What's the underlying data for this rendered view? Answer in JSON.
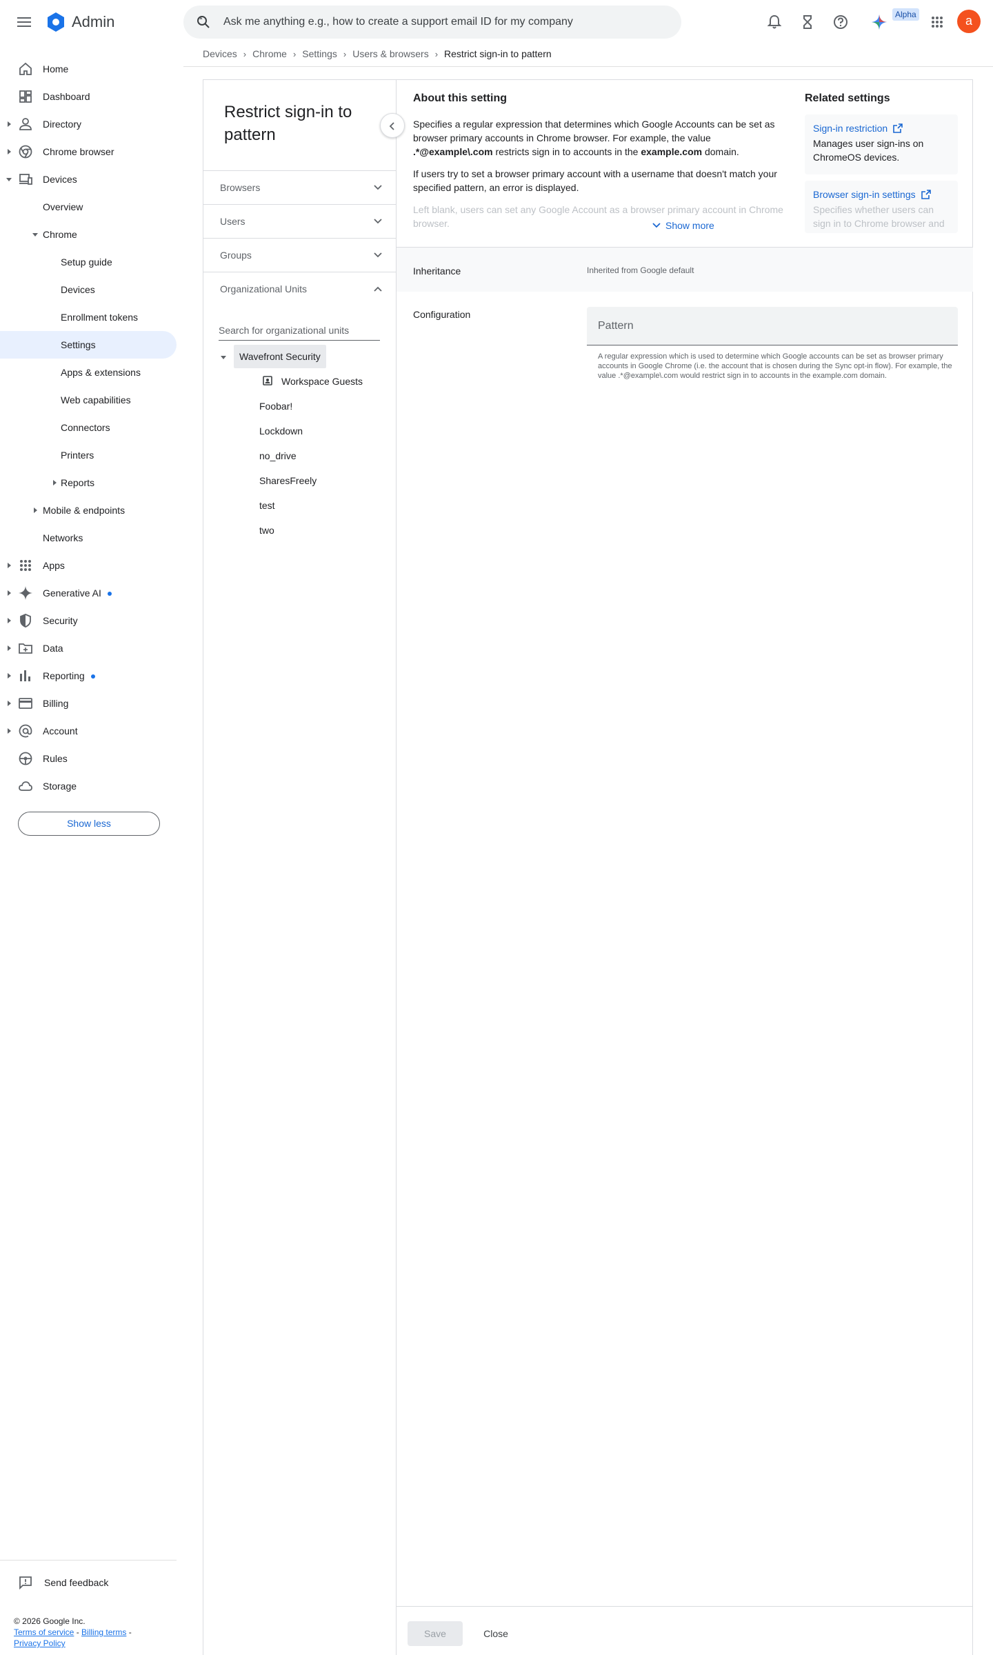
{
  "app": {
    "title": "Admin",
    "brand_color": "#1a73e8",
    "avatar_letter": "a",
    "avatar_color": "#f4511e"
  },
  "search": {
    "placeholder": "Ask me anything e.g., how to create a support email ID for my company"
  },
  "topbar": {
    "alpha_badge": "Alpha",
    "icons": [
      "notifications-icon",
      "hourglass-icon",
      "help-icon",
      "gemini-icon",
      "apps-grid-icon"
    ]
  },
  "breadcrumb": {
    "items": [
      "Devices",
      "Chrome",
      "Settings",
      "Users & browsers"
    ],
    "current": "Restrict sign-in to pattern"
  },
  "sidebar": {
    "items": [
      {
        "label": "Home",
        "icon": "home-icon"
      },
      {
        "label": "Dashboard",
        "icon": "dashboard-icon"
      },
      {
        "label": "Directory",
        "icon": "person-icon"
      },
      {
        "label": "Chrome browser",
        "icon": "chrome-icon"
      },
      {
        "label": "Devices",
        "icon": "devices-icon"
      },
      {
        "label": "Overview"
      },
      {
        "label": "Chrome"
      },
      {
        "label": "Setup guide"
      },
      {
        "label": "Devices"
      },
      {
        "label": "Enrollment tokens"
      },
      {
        "label": "Settings"
      },
      {
        "label": "Apps & extensions"
      },
      {
        "label": "Web capabilities"
      },
      {
        "label": "Connectors"
      },
      {
        "label": "Printers"
      },
      {
        "label": "Reports"
      },
      {
        "label": "Mobile & endpoints"
      },
      {
        "label": "Networks"
      },
      {
        "label": "Apps",
        "icon": "apps-icon"
      },
      {
        "label": "Generative AI",
        "icon": "sparkle-icon"
      },
      {
        "label": "Security",
        "icon": "shield-icon"
      },
      {
        "label": "Data",
        "icon": "data-folder-icon"
      },
      {
        "label": "Reporting",
        "icon": "bar-chart-icon"
      },
      {
        "label": "Billing",
        "icon": "credit-card-icon"
      },
      {
        "label": "Account",
        "icon": "at-sign-icon"
      },
      {
        "label": "Rules",
        "icon": "rules-icon"
      },
      {
        "label": "Storage",
        "icon": "cloud-icon"
      }
    ],
    "show_less": "Show less",
    "feedback": "Send feedback",
    "footer": {
      "copyright": "© 2026 Google Inc.",
      "terms": "Terms of service",
      "billing": "Billing terms",
      "privacy": "Privacy Policy",
      "sep": " - "
    }
  },
  "setting": {
    "title": "Restrict sign-in to pattern",
    "filters": [
      "Browsers",
      "Users",
      "Groups",
      "Organizational Units"
    ],
    "ou_search_placeholder": "Search for organizational units",
    "ou_root": "Wavefront Security",
    "ou_children": [
      "Workspace Guests"
    ],
    "ou_items": [
      "Foobar!",
      "Lockdown",
      "no_drive",
      "SharesFreely",
      "test",
      "two"
    ]
  },
  "about": {
    "title": "About this setting",
    "p1_a": "Specifies a regular expression that determines which Google Accounts can be set as browser primary accounts in Chrome browser. For example, the value ",
    "p1_b": ".*@example\\.com",
    "p1_c": " restricts sign in to accounts in the ",
    "p1_d": "example.com",
    "p1_e": " domain.",
    "p2": "If users try to set a browser primary account with a username that doesn't match your specified pattern, an error is displayed.",
    "p3": "Left blank, users can set any Google Account as a browser primary account in Chrome browser.",
    "show_more": "Show more"
  },
  "related": {
    "title": "Related settings",
    "cards": [
      {
        "link": "Sign-in restriction",
        "desc": "Manages user sign-ins on ChromeOS devices."
      },
      {
        "link": "Browser sign-in settings",
        "desc": "Specifies whether users can sign in to Chrome browser and sync..."
      }
    ]
  },
  "inheritance": {
    "label": "Inheritance",
    "value": "Inherited from Google default"
  },
  "configuration": {
    "label": "Configuration",
    "field_placeholder": "Pattern",
    "help": "A regular expression which is used to determine which Google accounts can be set as browser primary accounts in Google Chrome (i.e. the account that is chosen during the Sync opt-in flow). For example, the value .*@example\\.com would restrict sign in to accounts in the example.com domain."
  },
  "actions": {
    "save": "Save",
    "close": "Close"
  }
}
